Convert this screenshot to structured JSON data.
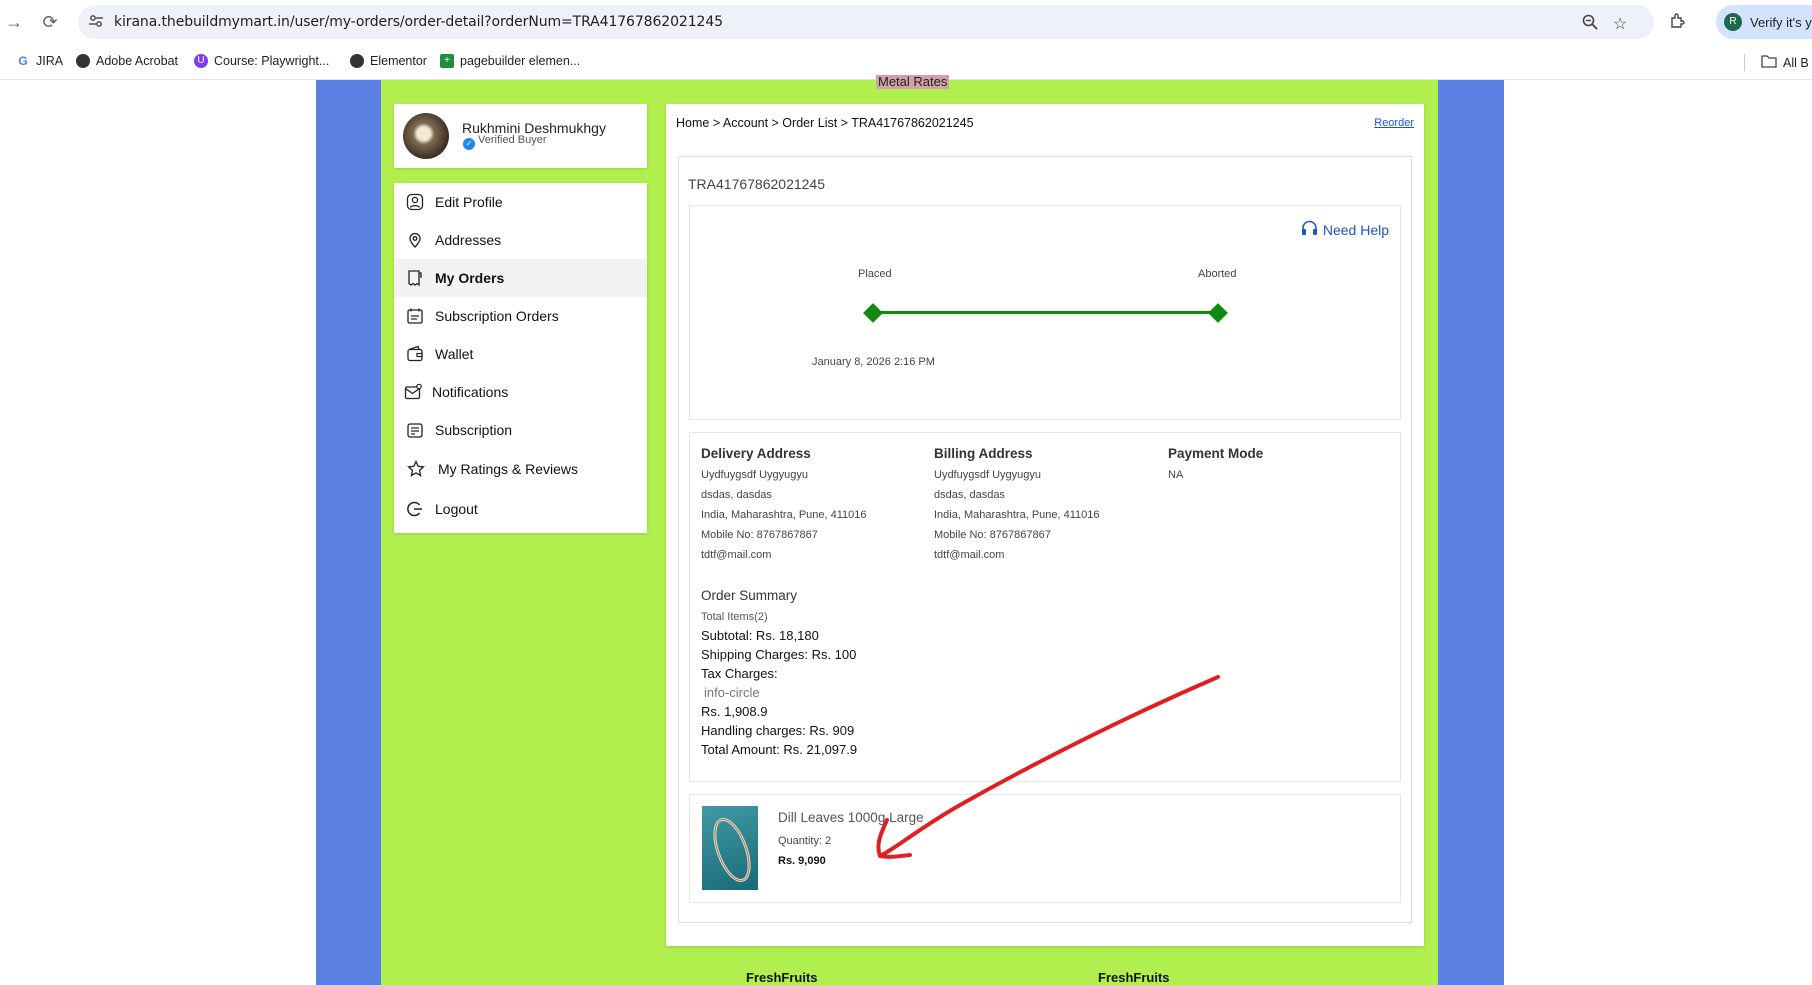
{
  "browser": {
    "url": "kirana.thebuildmymart.in/user/my-orders/order-detail?orderNum=TRA41767862021245",
    "profile_initial": "R",
    "profile_text": "Verify it's yo",
    "bookmarks": [
      "JIRA",
      "Adobe Acrobat",
      "Course: Playwright...",
      "Elementor",
      "pagebuilder elemen..."
    ],
    "all_bookmarks": "All B"
  },
  "header": {
    "metal_rates": "Metal Rates"
  },
  "user": {
    "name": "Rukhmini Deshmukhgy",
    "status": "Verified Buyer"
  },
  "sidebar": {
    "items": [
      {
        "label": "Edit Profile",
        "icon": "user-circle-icon"
      },
      {
        "label": "Addresses",
        "icon": "location-pin-icon"
      },
      {
        "label": "My Orders",
        "icon": "orders-icon"
      },
      {
        "label": "Subscription Orders",
        "icon": "subscription-orders-icon"
      },
      {
        "label": "Wallet",
        "icon": "wallet-icon"
      },
      {
        "label": "Notifications",
        "icon": "notifications-icon"
      },
      {
        "label": "Subscription",
        "icon": "subscription-icon"
      },
      {
        "label": "My Ratings & Reviews",
        "icon": "star-icon"
      },
      {
        "label": "Logout",
        "icon": "logout-icon"
      }
    ],
    "active": "My Orders"
  },
  "breadcrumb": "Home > Account > Order List > TRA41767862021245",
  "reorder": "Reorder",
  "order": {
    "id": "TRA41767862021245",
    "need_help": "Need Help",
    "stages": [
      {
        "label": "Placed",
        "date": "January 8, 2026 2:16 PM"
      },
      {
        "label": "Aborted",
        "date": ""
      }
    ]
  },
  "delivery": {
    "heading": "Delivery Address",
    "lines": [
      "Uydfuygsdf Uygyugyu",
      "dsdas, dasdas",
      "India, Maharashtra, Pune, 411016",
      "Mobile No: 8767867867",
      "tdtf@mail.com"
    ]
  },
  "billing": {
    "heading": "Billing Address",
    "lines": [
      "Uydfuygsdf Uygyugyu",
      "dsdas, dasdas",
      "India, Maharashtra, Pune, 411016",
      "Mobile No: 8767867867",
      "tdtf@mail.com"
    ]
  },
  "payment": {
    "heading": "Payment Mode",
    "value": "NA"
  },
  "summary": {
    "title": "Order Summary",
    "total_items": "Total Items(2)",
    "subtotal": "Subtotal: Rs. 18,180",
    "shipping": "Shipping Charges: Rs. 100",
    "tax": "Tax Charges:",
    "tax_info": "info-circle",
    "tax_value": "Rs. 1,908.9",
    "handling": "Handling charges: Rs. 909",
    "total": "Total Amount: Rs. 21,097.9"
  },
  "item": {
    "name": "Dill Leaves 1000g Large",
    "quantity": "Quantity: 2",
    "price": "Rs. 9,090"
  },
  "footer": {
    "left": "FreshFruits",
    "right": "FreshFruits"
  },
  "colors": {
    "page_green": "#b1ef4f",
    "page_blue": "#5b7fe3",
    "track_green": "#108a10",
    "link_blue": "#1a56c8",
    "annotation_red": "#e02020"
  }
}
